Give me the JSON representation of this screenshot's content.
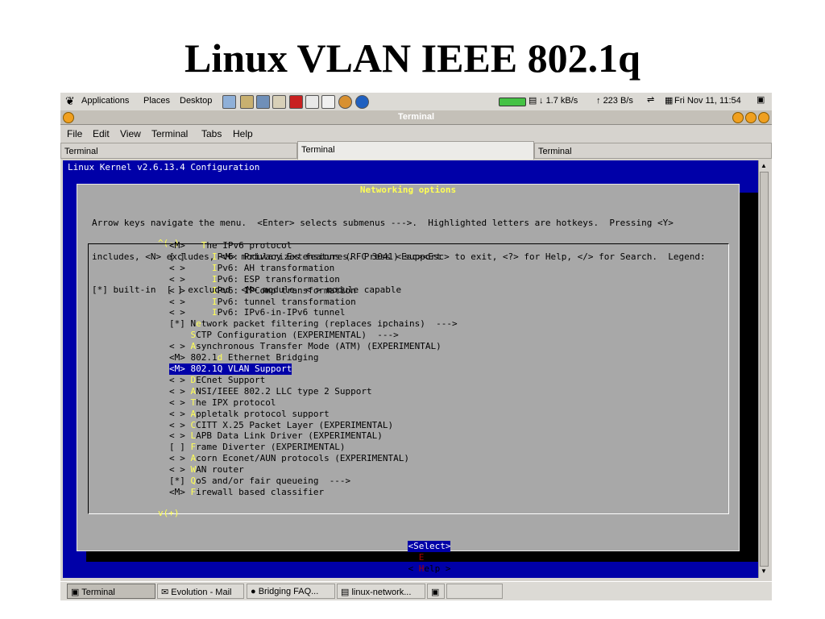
{
  "slide": {
    "title": "Linux VLAN IEEE 802.1q"
  },
  "top_panel": {
    "menus": [
      "Applications",
      "Places",
      "Desktop"
    ],
    "net_down": "1.7 kB/s",
    "net_up": "223 B/s",
    "clock": "Fri Nov 11, 11:54"
  },
  "window": {
    "title": "Terminal"
  },
  "menubar": [
    "File",
    "Edit",
    "View",
    "Terminal",
    "Tabs",
    "Help"
  ],
  "tabs": [
    "Terminal",
    "Terminal",
    "Terminal"
  ],
  "terminal": {
    "header": "Linux Kernel v2.6.13.4 Configuration",
    "dialog_title": " Networking options ",
    "help_lines": [
      "Arrow keys navigate the menu.  <Enter> selects submenus --->.  Highlighted letters are hotkeys.  Pressing <Y>",
      "includes, <N> excludes, <M> modularizes features.  Press <Esc><Esc> to exit, <?> for Help, </> for Search.  Legend:",
      "[*] built-in  [ ] excluded  <M> module  < > module capable"
    ],
    "scroll_up": "^(-)",
    "scroll_down": "v(+)",
    "items": [
      "<M>   The IPv6 protocol",
      "[ ]     IPv6: Privacy Extensions (RFC 3041) support",
      "< >     IPv6: AH transformation",
      "< >     IPv6: ESP transformation",
      "< >     IPv6: IPComp transformation",
      "< >     IPv6: tunnel transformation",
      "< >     IPv6: IPv6-in-IPv6 tunnel",
      "[*] Network packet filtering (replaces ipchains)  --->",
      "    SCTP Configuration (EXPERIMENTAL)  --->",
      "< > Asynchronous Transfer Mode (ATM) (EXPERIMENTAL)",
      "<M> 802.1d Ethernet Bridging",
      "<M> 802.1Q VLAN Support",
      "< > DECnet Support",
      "< > ANSI/IEEE 802.2 LLC type 2 Support",
      "< > The IPX protocol",
      "< > Appletalk protocol support",
      "< > CCITT X.25 Packet Layer (EXPERIMENTAL)",
      "< > LAPB Data Link Driver (EXPERIMENTAL)",
      "[ ] Frame Diverter (EXPERIMENTAL)",
      "< > Acorn Econet/AUN protocols (EXPERIMENTAL)",
      "< > WAN router",
      "[*] QoS and/or fair queueing  --->",
      "<M> Firewall based classifier"
    ],
    "hotkey_index": [
      6,
      8,
      8,
      8,
      8,
      8,
      8,
      5,
      4,
      4,
      9,
      4,
      4,
      4,
      4,
      4,
      4,
      4,
      4,
      4,
      4,
      4,
      4
    ],
    "selected_index": 11,
    "buttons": [
      "<Select>",
      "< Exit >",
      "< Help >"
    ]
  },
  "taskbar": {
    "items": [
      "Terminal",
      "Evolution - Mail",
      "Bridging FAQ...",
      "linux-network..."
    ]
  },
  "colors": {
    "terminal_bg": "#0000a8",
    "dialog_bg": "#a8a8a8",
    "hotkey": "#ffff54"
  }
}
